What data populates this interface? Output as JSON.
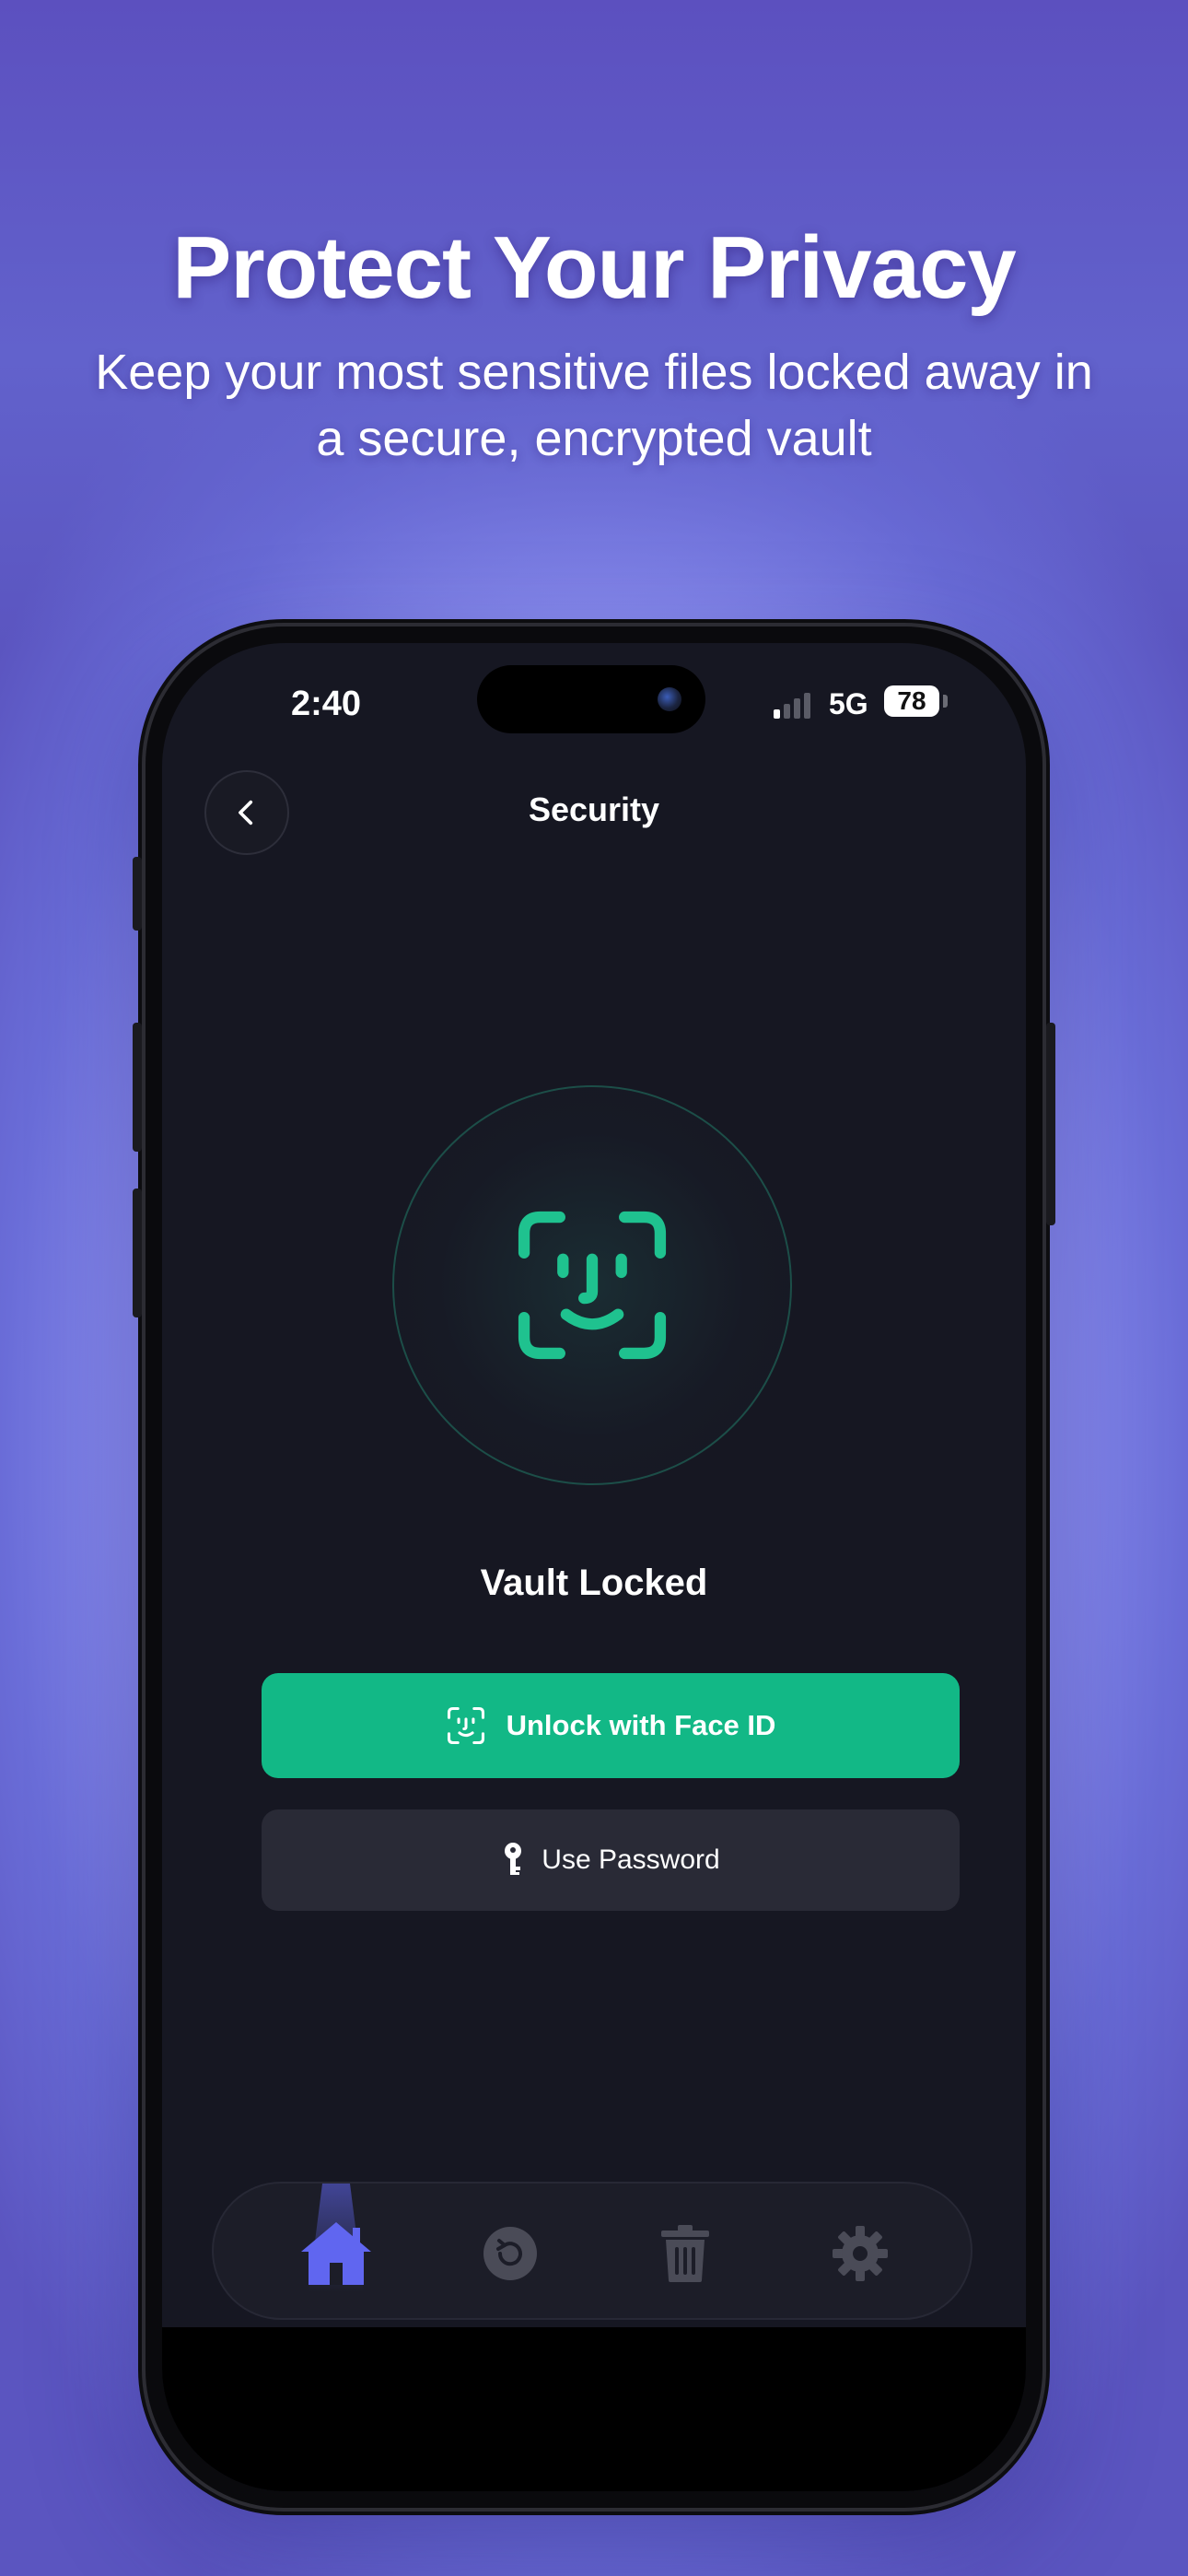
{
  "promo": {
    "headline": "Protect Your Privacy",
    "subhead": "Keep your most sensitive files locked away in a secure, encrypted vault"
  },
  "status_bar": {
    "time": "2:40",
    "network": "5G",
    "battery": "78",
    "signal_bars_active": 1
  },
  "nav": {
    "title": "Security",
    "back_icon": "chevron-left-icon"
  },
  "lock": {
    "icon": "face-id-icon",
    "status": "Vault Locked"
  },
  "actions": {
    "unlock_face_id": "Unlock with Face ID",
    "use_password": "Use Password"
  },
  "tabbar": {
    "items": [
      {
        "icon": "home-icon",
        "active": true
      },
      {
        "icon": "history-icon",
        "active": false
      },
      {
        "icon": "trash-icon",
        "active": false
      },
      {
        "icon": "gear-icon",
        "active": false
      }
    ]
  },
  "colors": {
    "accent_green": "#12b886",
    "tab_active": "#6066f0",
    "tab_inactive": "#4a4b57",
    "screen_bg": "#161722",
    "promo_bg": "#5c50bf"
  }
}
